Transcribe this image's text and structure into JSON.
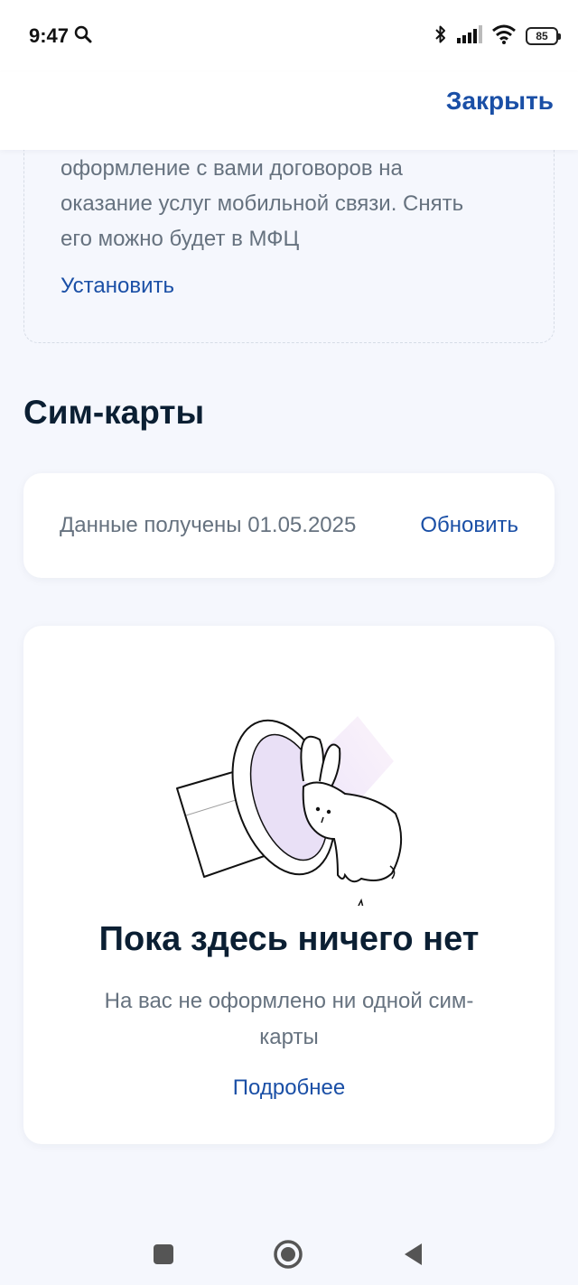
{
  "status_bar": {
    "time": "9:47",
    "battery": "85"
  },
  "header": {
    "close_label": "Закрыть"
  },
  "notice_card": {
    "text_lines": [
      "оформление с вами договоров на",
      "оказание услуг мобильной связи. Снять",
      "его можно будет в МФЦ"
    ],
    "action_label": "Установить"
  },
  "sim_section": {
    "title": "Сим-карты"
  },
  "sync_card": {
    "text": "Данные получены 01.05.2025",
    "action_label": "Обновить"
  },
  "empty_state": {
    "title": "Пока здесь ничего нет",
    "subtitle_lines": [
      "На вас не оформлено ни одной сим-",
      "карты"
    ],
    "link_label": "Подробнее"
  },
  "colors": {
    "accent": "#1a4fa6",
    "text_primary": "#0b1f33",
    "text_secondary": "#66727f",
    "background": "#f5f7fd"
  },
  "icons": [
    "search-icon",
    "bluetooth-icon",
    "signal-icon",
    "wifi-icon",
    "battery-icon",
    "home-square-icon",
    "circle-home-icon",
    "back-triangle-icon"
  ]
}
